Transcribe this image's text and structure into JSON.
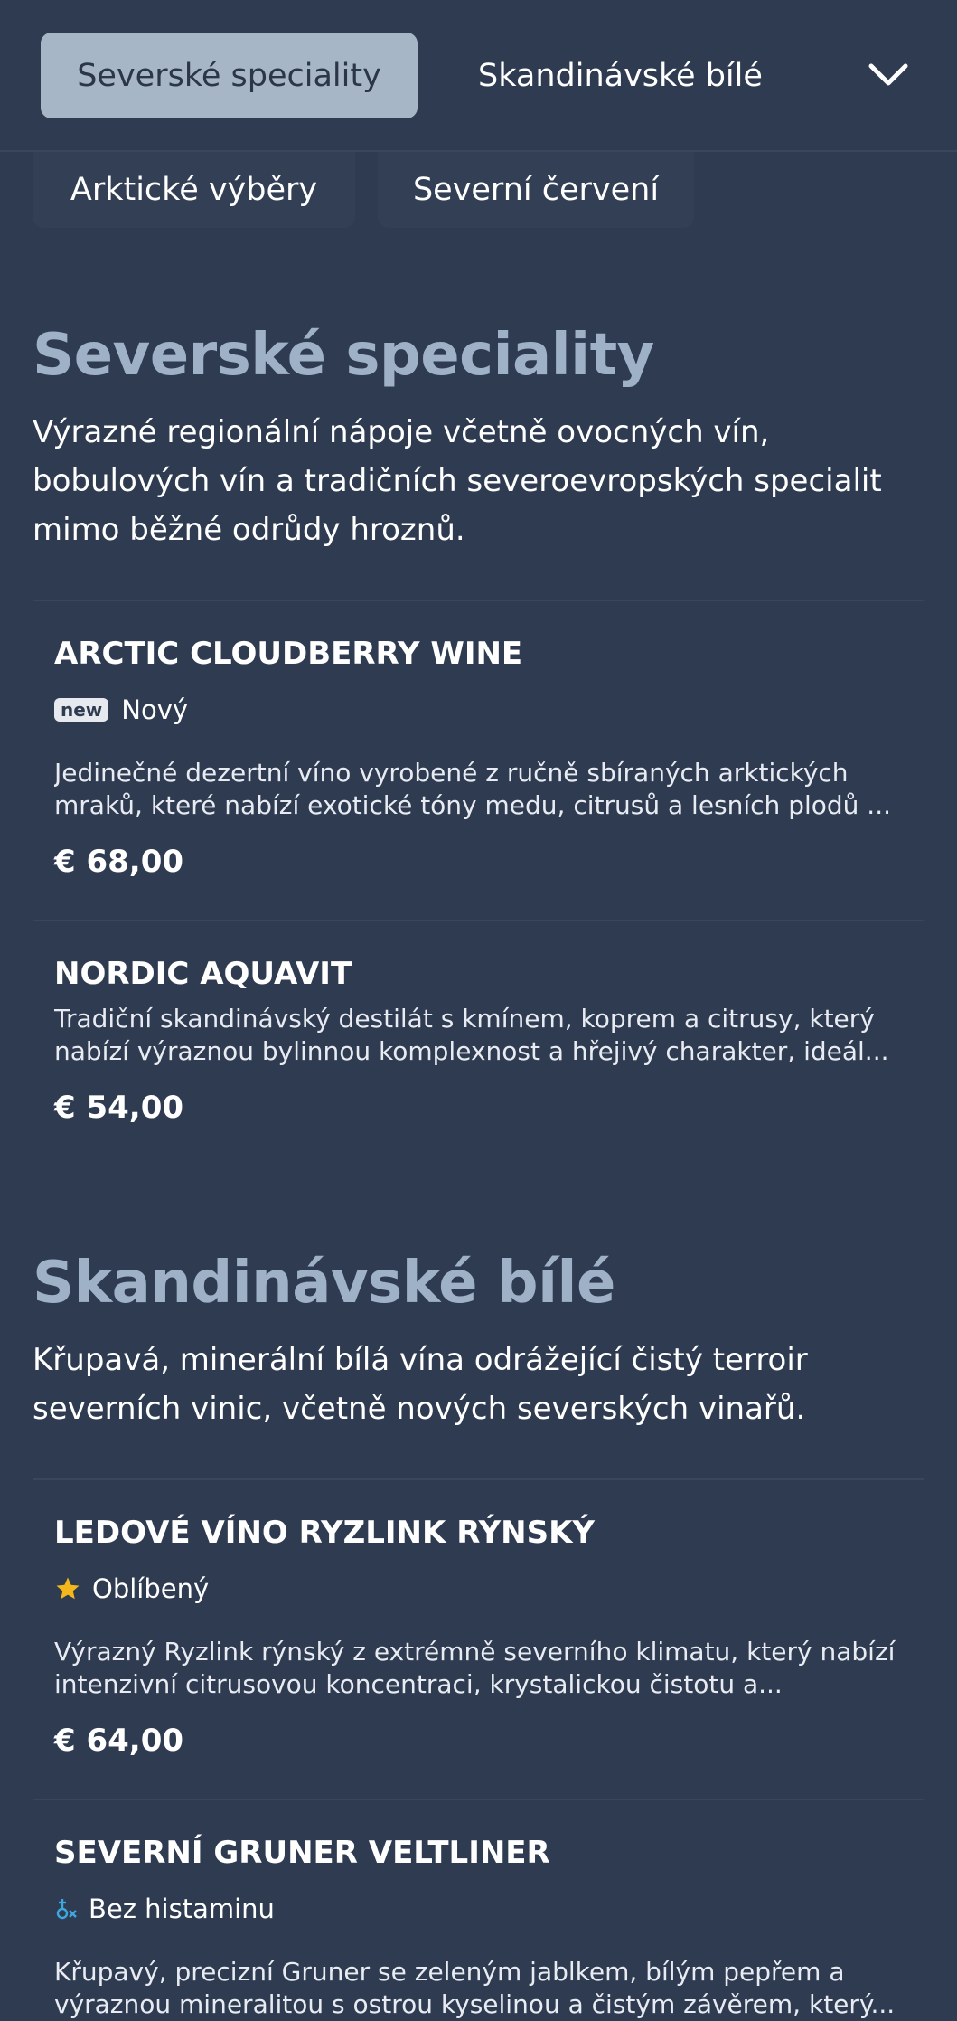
{
  "nav": {
    "active_tab": "Severské speciality",
    "second_tab": "Skandinávské bílé",
    "subtabs": [
      "Arktické výběry",
      "Severní červení"
    ],
    "dropdown_icon": "chevron-down-icon"
  },
  "sections": [
    {
      "title": "Severské speciality",
      "description": "Výrazné regionální nápoje včetně ovocných vín, bobulových vín a tradičních severoevropských specialit mimo běžné odrůdy hroznů.",
      "items": [
        {
          "name": "ARCTIC CLOUDBERRY WINE",
          "badge_tag": "new",
          "badge_label": "Nový",
          "description_lines": [
            "Jedinečné dezertní víno vyrobené z ručně sbíraných arktických",
            "mraků, které nabízí exotické tóny medu, citrusů a lesních plodů ..."
          ],
          "price": "€ 68,00"
        },
        {
          "name": "NORDIC AQUAVIT",
          "description_lines": [
            "Tradiční skandinávský destilát s kmínem, koprem a citrusy, který",
            "nabízí výraznou bylinnou komplexnost a hřejivý charakter, ideál..."
          ],
          "price": "€ 54,00"
        }
      ]
    },
    {
      "title": "Skandinávské bílé",
      "description": "Křupavá, minerální bílá vína odrážející čistý terroir severních vinic, včetně nových severských vinařů.",
      "items": [
        {
          "name": "LEDOVÉ VÍNO RYZLINK RÝNSKÝ",
          "badge_icon": "star-icon",
          "badge_label": "Oblíbený",
          "description_lines": [
            "Výrazný Ryzlink rýnský z extrémně severního klimatu, který nabízí",
            "intenzivní citrusovou koncentraci, krystalickou čistotu a..."
          ],
          "price": "€ 64,00"
        },
        {
          "name": "SEVERNÍ GRUNER VELTLINER",
          "badge_icon": "histamine-free-icon",
          "badge_label": "Bez histaminu",
          "description_lines": [
            "Křupavý, precizní Gruner se zeleným jablkem, bílým pepřem a",
            "výraznou mineralitou s ostrou kyselinou a čistým závěrem, který..."
          ]
        }
      ]
    }
  ],
  "colors": {
    "background": "#2e3b50",
    "active_tab": "#a7b6c6",
    "section_title": "#9fb1c6",
    "star": "#f5b81c",
    "histamine_icon": "#3fa7e0"
  }
}
